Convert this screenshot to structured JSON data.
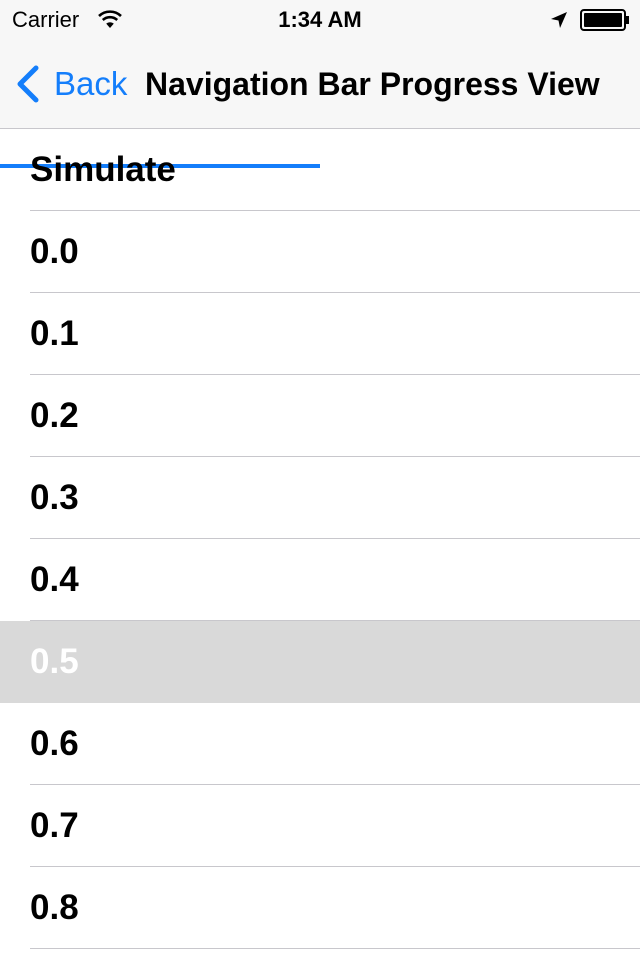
{
  "status_bar": {
    "carrier": "Carrier",
    "time": "1:34 AM",
    "icons": [
      "wifi-icon",
      "location-arrow-icon",
      "battery-icon"
    ]
  },
  "nav": {
    "back_label": "Back",
    "title": "Navigation Bar Progress View",
    "progress": 0.5,
    "tint": "#147efb"
  },
  "table": {
    "rows": [
      {
        "label": "Simulate",
        "selected": false
      },
      {
        "label": "0.0",
        "selected": false
      },
      {
        "label": "0.1",
        "selected": false
      },
      {
        "label": "0.2",
        "selected": false
      },
      {
        "label": "0.3",
        "selected": false
      },
      {
        "label": "0.4",
        "selected": false
      },
      {
        "label": "0.5",
        "selected": true
      },
      {
        "label": "0.6",
        "selected": false
      },
      {
        "label": "0.7",
        "selected": false
      },
      {
        "label": "0.8",
        "selected": false
      }
    ],
    "selection_color": "#d9d9d9",
    "separator_color": "#c8c7cc"
  }
}
